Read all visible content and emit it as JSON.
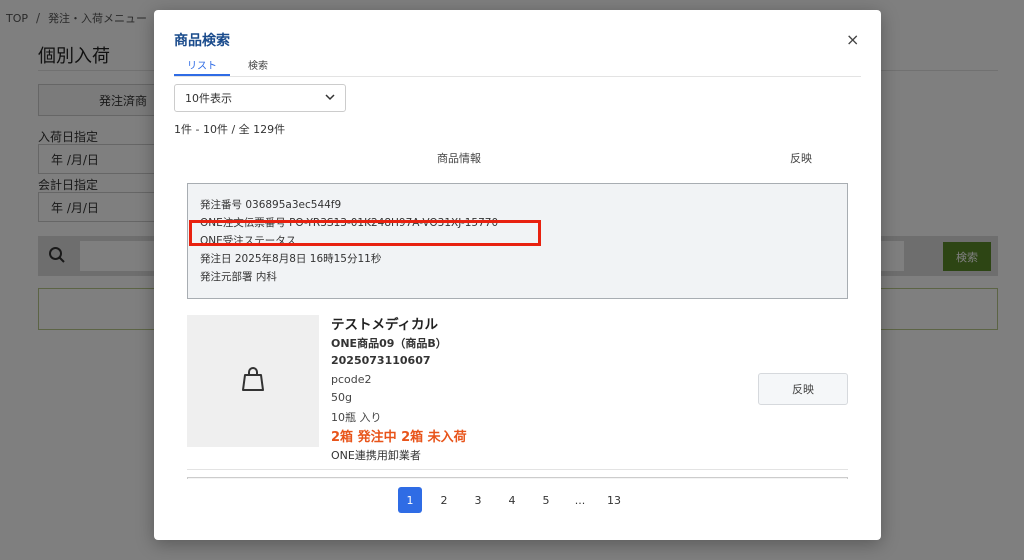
{
  "background": {
    "breadcrumb": [
      "TOP",
      "/",
      "発注・入荷メニュー"
    ],
    "title": "個別入荷",
    "tab_label": "発注済商",
    "arrival_date_label": "入荷日指定",
    "arrival_date_value": "年 /月/日",
    "accounting_date_label": "会計日指定",
    "accounting_date_value": "年 /月/日",
    "search_button": "検索"
  },
  "modal": {
    "title": "商品検索",
    "close": "×",
    "tabs": [
      {
        "label": "リスト",
        "active": true
      },
      {
        "label": "検索",
        "active": false
      }
    ],
    "page_size": "10件表示",
    "result_count": "1件 - 10件 / 全 129件",
    "columns": {
      "info": "商品情報",
      "reflect": "反映"
    },
    "order": {
      "order_number": "発注番号  036895a3ec544f9",
      "slip_number": "ONE注文伝票番号  PO-YR3S13-01K248H97A-VO31XJ-15770",
      "status": "ONE受注ステータス",
      "order_date": "発注日  2025年8月8日 16時15分11秒",
      "department": "発注元部署  内科"
    },
    "product": {
      "maker": "テストメディカル",
      "name": "ONE商品09（商品B）",
      "jan": "2025073110607",
      "pcode": "pcode2",
      "size": "50g",
      "package": "10瓶 入り",
      "status": "2箱 発注中 2箱 未入荷",
      "vendor": "ONE連携用卸業者",
      "reflect_button": "反映"
    },
    "pagination": {
      "pages": [
        "1",
        "2",
        "3",
        "4",
        "5",
        "...",
        "13"
      ],
      "current": "1"
    }
  },
  "colors": {
    "accent": "#2f6ce5",
    "title": "#1a4b8c",
    "highlight": "#e8210f",
    "status": "#e8541a",
    "search_button": "#5b8a28"
  }
}
